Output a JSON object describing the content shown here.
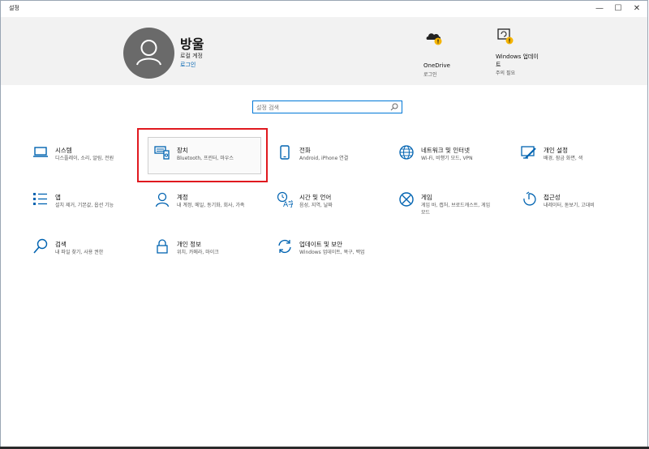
{
  "window": {
    "title": "설정",
    "minimize": "—",
    "maximize": "☐",
    "close": "✕"
  },
  "header": {
    "user_name": "방울",
    "account_type": "로컬 계정",
    "signin_link": "로그인",
    "onedrive": {
      "label": "OneDrive",
      "sub": "로그인"
    },
    "update": {
      "label_line1": "Windows 업데이",
      "label_line2": "트",
      "sub": "주의 필요"
    }
  },
  "search": {
    "placeholder": "설정 검색"
  },
  "tiles": [
    {
      "id": "system",
      "title": "시스템",
      "desc": "디스플레이, 소리, 알림, 전원",
      "icon": "laptop-icon"
    },
    {
      "id": "devices",
      "title": "장치",
      "desc": "Bluetooth, 프린터, 마우스",
      "icon": "devices-icon"
    },
    {
      "id": "phone",
      "title": "전화",
      "desc": "Android, iPhone 연결",
      "icon": "phone-icon"
    },
    {
      "id": "network",
      "title": "네트워크 및 인터넷",
      "desc": "Wi-Fi, 비행기 모드, VPN",
      "icon": "globe-icon"
    },
    {
      "id": "personalization",
      "title": "개인 설정",
      "desc": "배경, 잠금 화면, 색",
      "icon": "personalization-icon"
    },
    {
      "id": "apps",
      "title": "앱",
      "desc": "설치 제거, 기본값, 옵션 기능",
      "icon": "apps-list-icon"
    },
    {
      "id": "accounts",
      "title": "계정",
      "desc": "내 계정, 메일, 동기화, 회사, 가족",
      "icon": "person-icon"
    },
    {
      "id": "time",
      "title": "시간 및 언어",
      "desc": "음성, 지역, 날짜",
      "icon": "time-language-icon"
    },
    {
      "id": "gaming",
      "title": "게임",
      "desc": "게임 바, 캡처, 브로드캐스트, 게임 모드",
      "icon": "xbox-icon"
    },
    {
      "id": "ease",
      "title": "접근성",
      "desc": "내레이터, 돋보기, 고대비",
      "icon": "accessibility-icon"
    },
    {
      "id": "search",
      "title": "검색",
      "desc": "내 파일 찾기, 사용 권한",
      "icon": "search-icon"
    },
    {
      "id": "privacy",
      "title": "개인 정보",
      "desc": "위치, 카메라, 마이크",
      "icon": "lock-icon"
    },
    {
      "id": "update",
      "title": "업데이트 및 보안",
      "desc": "Windows 업데이트, 복구, 백업",
      "icon": "sync-icon"
    }
  ],
  "colors": {
    "accent": "#0078d7",
    "highlight": "#e0191f",
    "warning": "#f5b400"
  }
}
